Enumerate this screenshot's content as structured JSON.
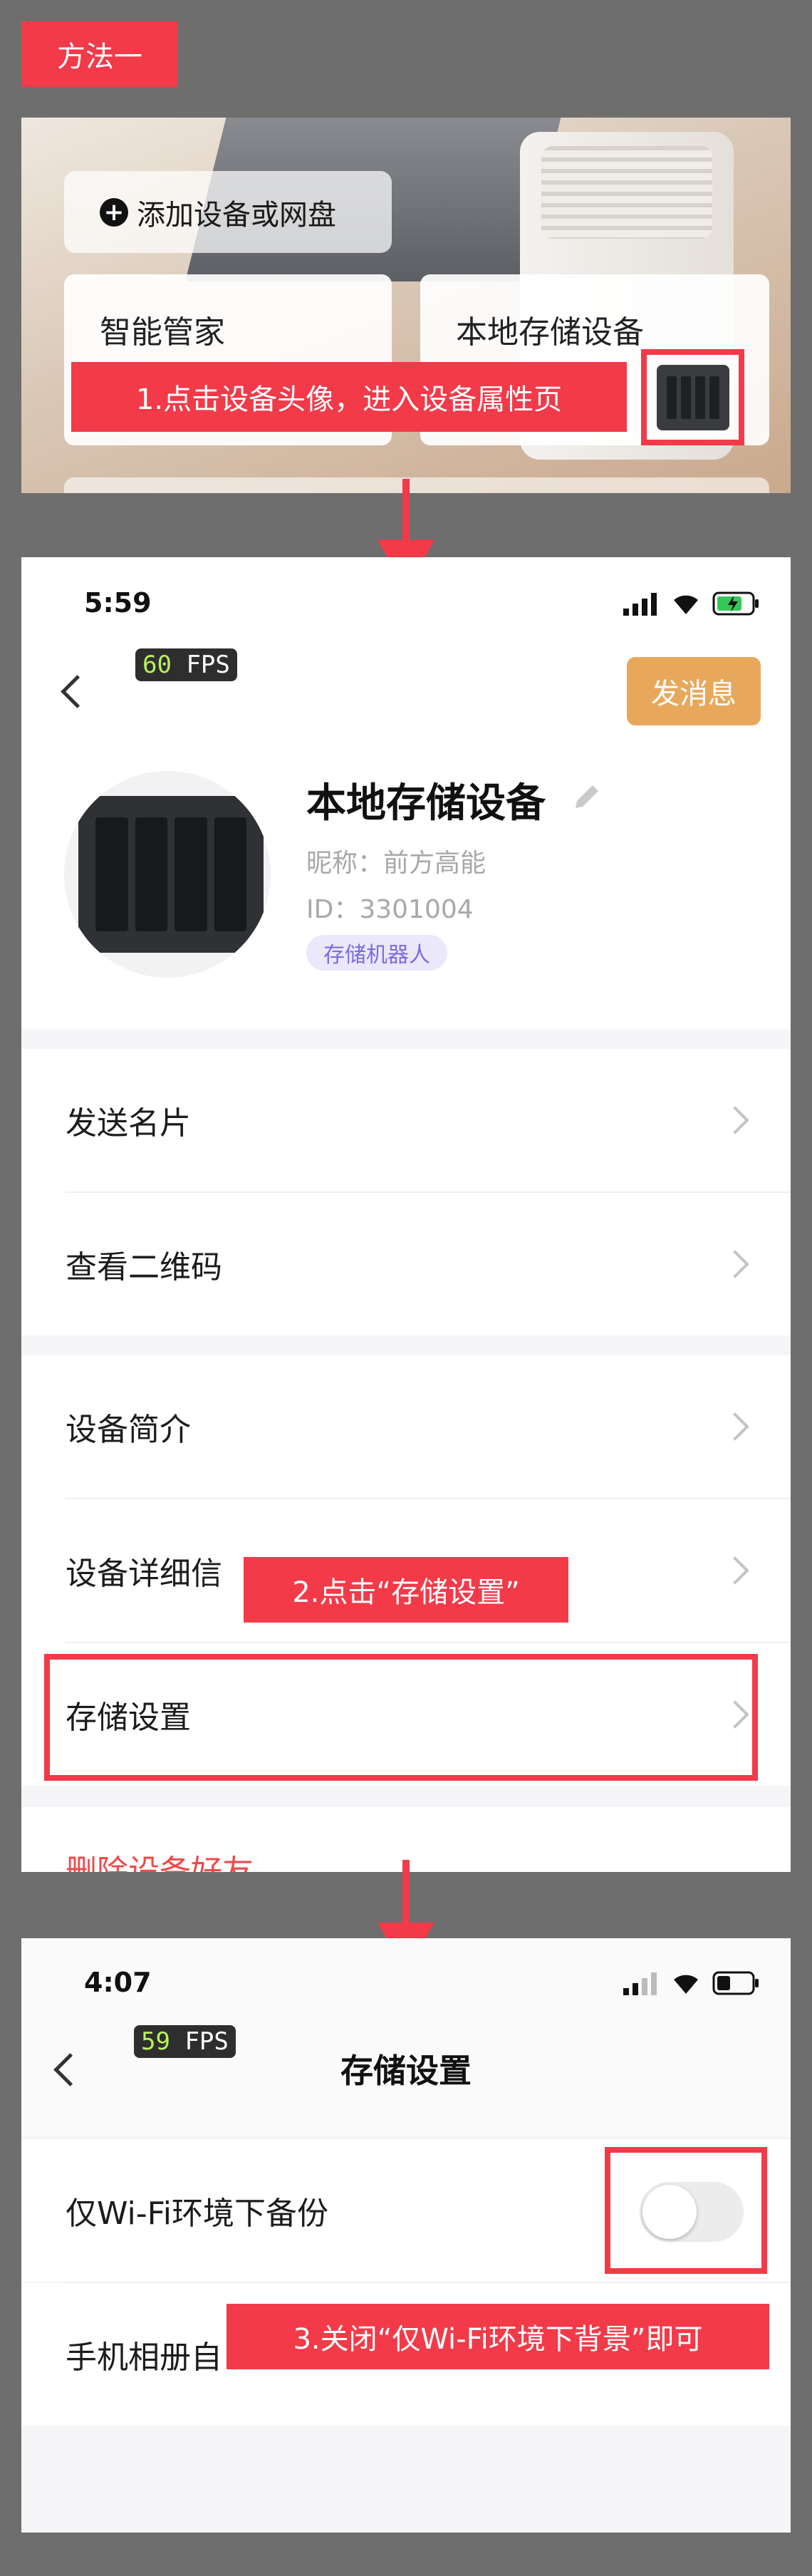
{
  "colors": {
    "accent_red": "#f23a49",
    "button_orange": "#e8a85c",
    "tag_purple": "#7b6de0",
    "fps_green": "#b8f25b"
  },
  "method_label": "方法一",
  "section1": {
    "add_button": "添加设备或网盘",
    "card_left": "智能管家",
    "card_right": "本地存储设备",
    "step_label": "1.点击设备头像，进入设备属性页"
  },
  "section2": {
    "time": "5:59",
    "fps_value": "60",
    "fps_unit": "FPS",
    "send_message": "发消息",
    "device_name": "本地存储设备",
    "nickname": "昵称：前方高能",
    "id": "ID：3301004",
    "tag": "存储机器人",
    "menu": {
      "send_card": "发送名片",
      "view_qr": "查看二维码",
      "device_intro": "设备简介",
      "device_detail": "设备详细信",
      "storage_settings": "存储设置",
      "delete": "删除设备好友"
    },
    "step_label": "2.点击“存储设置”"
  },
  "section3": {
    "time": "4:07",
    "fps_value": "59",
    "fps_unit": "FPS",
    "title": "存储设置",
    "wifi_only": "仅Wi-Fi环境下备份",
    "wifi_only_enabled": false,
    "album": "手机相册自",
    "step_label": "3.关闭“仅Wi-Fi环境下背景”即可"
  },
  "icons": [
    "plus-circle-icon",
    "nas-icon",
    "back-chevron-icon",
    "edit-pencil-icon",
    "chevron-right-icon",
    "signal-icon",
    "wifi-icon",
    "battery-icon",
    "arrow-down-icon"
  ]
}
